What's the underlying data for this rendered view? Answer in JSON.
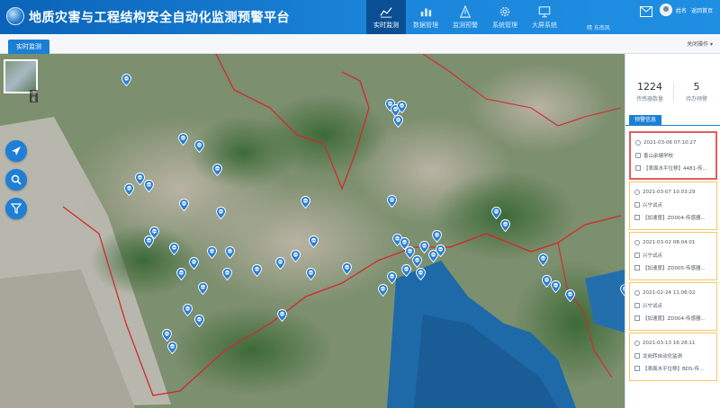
{
  "app": {
    "title": "地质灾害与工程结构安全自动化监测预警平台"
  },
  "nav": {
    "items": [
      {
        "label": "实时监测",
        "icon": "chart-line-icon",
        "active": true
      },
      {
        "label": "数据管理",
        "icon": "bar-chart-icon",
        "active": false
      },
      {
        "label": "监测预警",
        "icon": "alert-tower-icon",
        "active": false
      },
      {
        "label": "系统管理",
        "icon": "gear-icon",
        "active": false
      },
      {
        "label": "大屏系统",
        "icon": "monitor-icon",
        "active": false
      }
    ],
    "sub_text": "晴  东南风"
  },
  "header_right": {
    "user_name": "姓名",
    "exit_label": "返回首页"
  },
  "tabs": {
    "items": [
      {
        "label": "实时监测"
      }
    ],
    "actions_label": "关闭操作 ▾"
  },
  "map": {
    "thumb_label": "卫星"
  },
  "stats": {
    "sensor_count": "1224",
    "sensor_label": "传感器数量",
    "alarm_count": "5",
    "alarm_label": "待办预警"
  },
  "warnings": {
    "title": "预警信息",
    "items": [
      {
        "time": "2021-03-06 07:10:27",
        "place": "香山余塘学校",
        "detail": "【表面水平位移】4481-传..."
      },
      {
        "time": "2021-03-07 10:03:29",
        "place": "兴宁试点",
        "detail": "【加速度】ZD004-传感器..."
      },
      {
        "time": "2021-03-02 08:04:01",
        "place": "兴宁试点",
        "detail": "【加速度】ZD005-传感器..."
      },
      {
        "time": "2021-02-24 11:06:02",
        "place": "兴宁试点",
        "detail": "【加速度】ZD004-传感器..."
      },
      {
        "time": "2021-03-13 16:28:11",
        "place": "龙岗转自动化监测",
        "detail": "【表面水平位移】BDS-传..."
      }
    ]
  },
  "colors": {
    "header_blue": "#1b86db",
    "active_nav": "#0a4f94",
    "alarm_red": "#e35d5d",
    "alarm_yellow": "#f3c663",
    "boundary_red": "#d12a2a",
    "pin_blue": "#2b7fd4"
  }
}
